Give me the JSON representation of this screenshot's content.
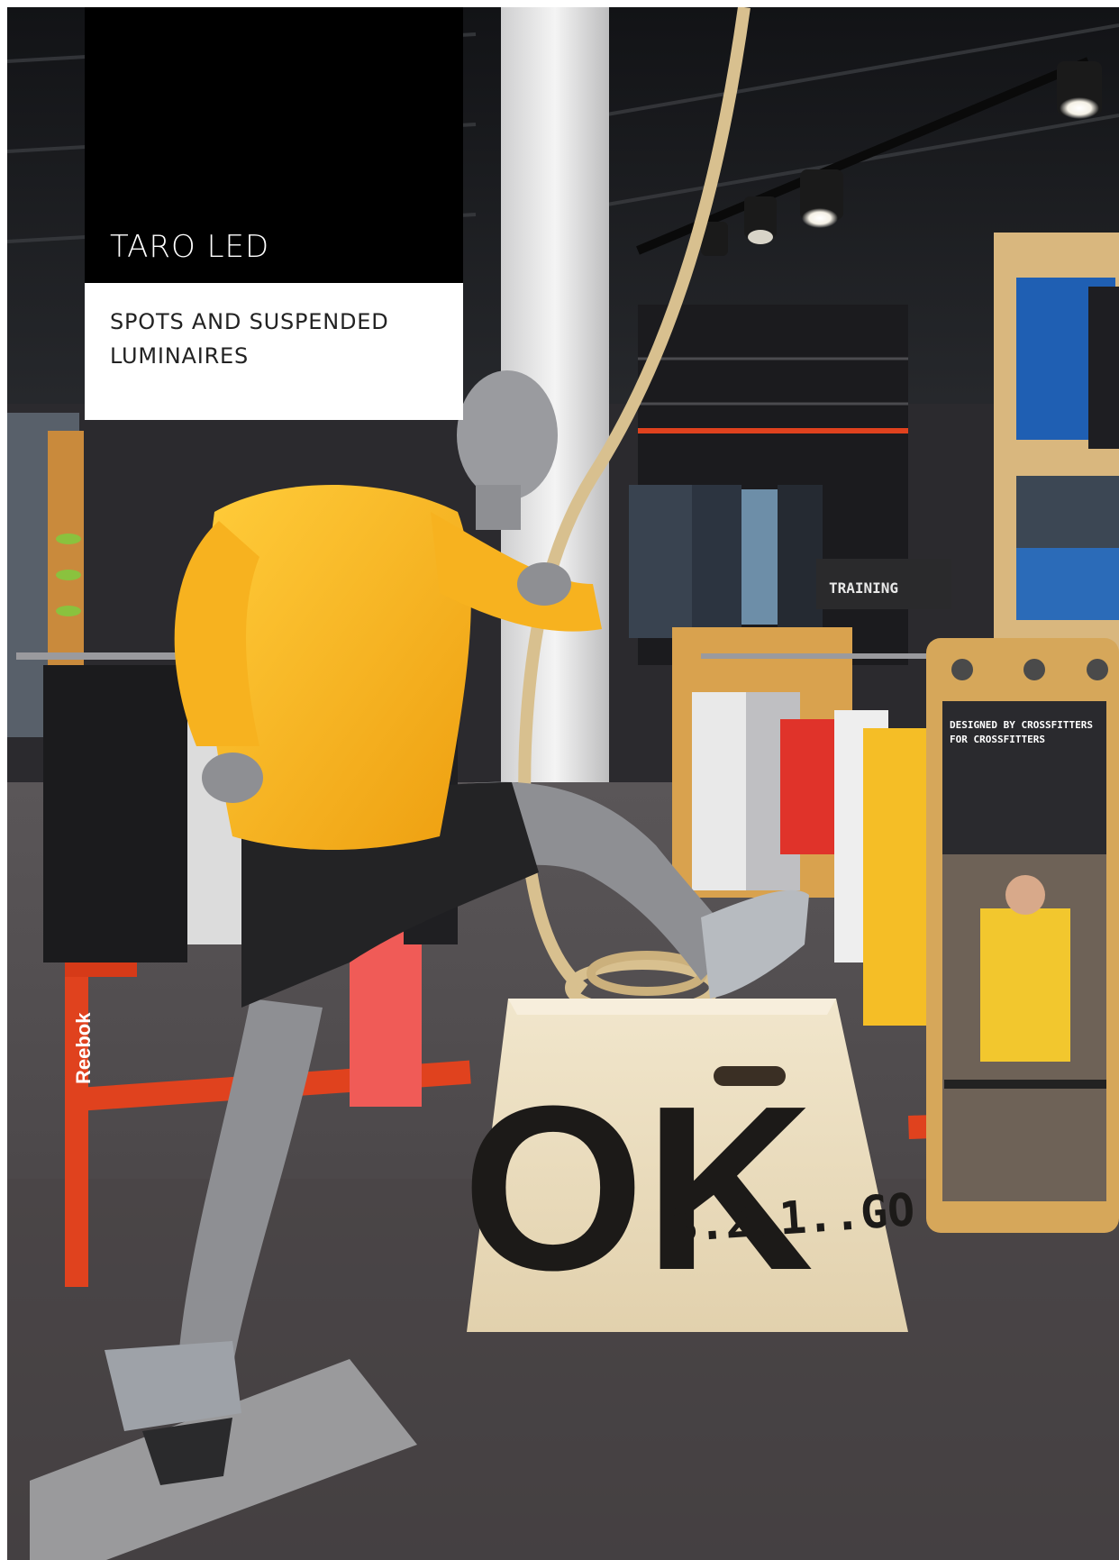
{
  "header": {
    "title": "TARO LED",
    "subtitle_line1": "SPOTS AND SUSPENDED",
    "subtitle_line2": "LUMINAIRES"
  },
  "photo": {
    "box_letters": "OK",
    "box_slogan": "3.2.1..GO",
    "poster_heading_line1": "DESIGNED BY CROSSFITTERS",
    "poster_heading_line2": "FOR CROSSFITTERS",
    "training_sign": "TRAINING",
    "rack_brand": "Reebok"
  },
  "colors": {
    "title_bg": "#000000",
    "title_text": "#ffffff",
    "subtitle_bg": "#ffffff",
    "jacket_yellow": "#f7b21f",
    "rack_red": "#e0421e"
  }
}
